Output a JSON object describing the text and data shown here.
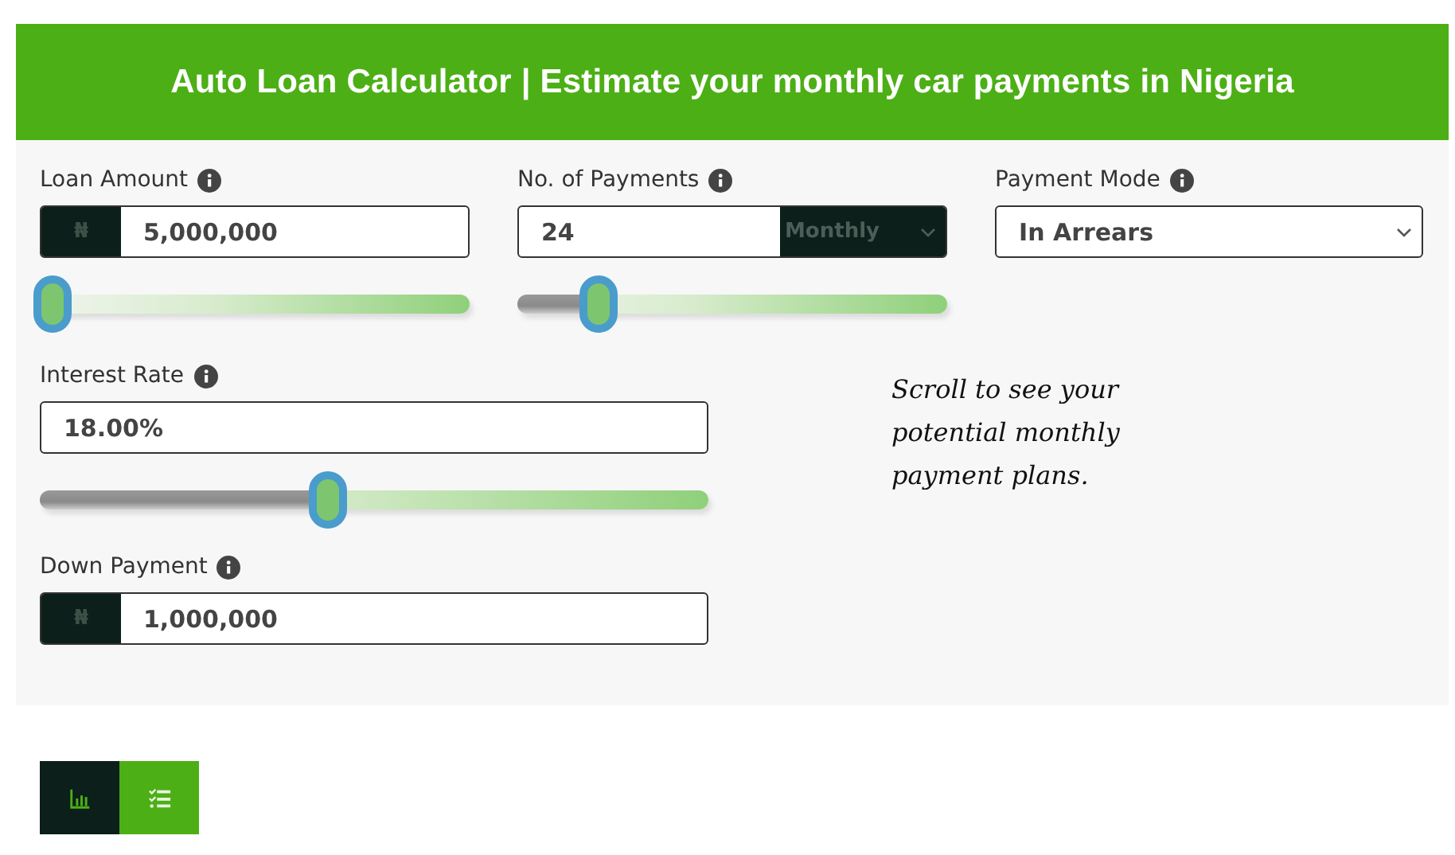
{
  "header": {
    "title": "Auto Loan Calculator | Estimate your monthly car payments in Nigeria"
  },
  "fields": [
    {
      "kind": "currency",
      "label": "Loan Amount",
      "prefix": "₦",
      "value": "5,000,000",
      "level": 0.03
    },
    {
      "kind": "select-combo",
      "label": "No. of Payments",
      "value": "24",
      "select": "Monthly",
      "level": 0.19
    },
    {
      "kind": "select",
      "label": "Payment Mode",
      "value": "In Arrears"
    },
    {
      "kind": "plain",
      "label": "Interest Rate",
      "value": "18.00%",
      "level": 0.43
    },
    {
      "kind": "currency",
      "label": "Down Payment",
      "prefix": "₦",
      "value": "1,000,000"
    }
  ],
  "note": "Scroll to see your potential monthly payment plans.",
  "view_tabs": [
    {
      "kind": "chart",
      "selected": true
    },
    {
      "kind": "list",
      "selected": false
    }
  ]
}
